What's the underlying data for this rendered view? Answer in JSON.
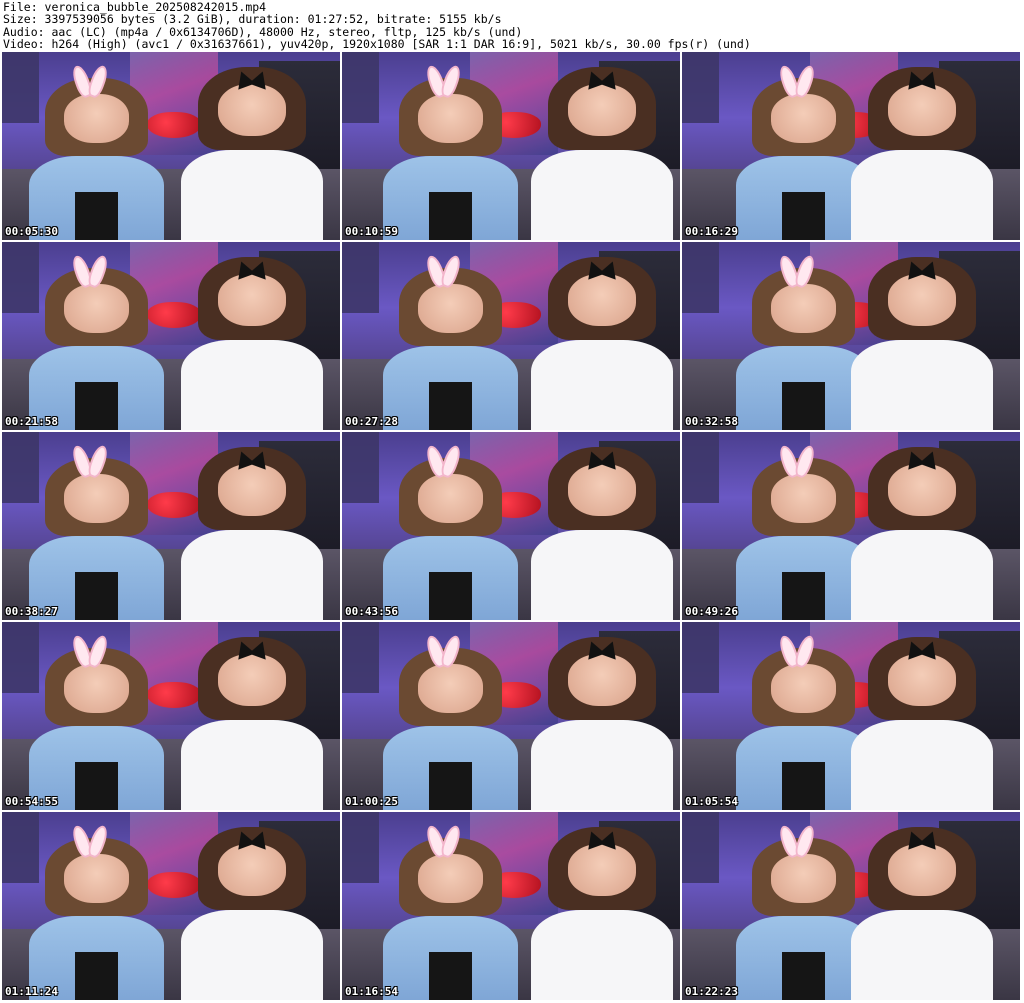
{
  "header": {
    "line1": "File: veronica_bubble_202508242015.mp4",
    "line2": "Size: 3397539056 bytes (3.2 GiB), duration: 01:27:52, bitrate: 5155 kb/s",
    "line3": "Audio: aac (LC) (mp4a / 0x6134706D), 48000 Hz, stereo, fltp, 125 kb/s (und)",
    "line4": "Video: h264 (High) (avc1 / 0x31637661), yuv420p, 1920x1080 [SAR 1:1 DAR 16:9], 5021 kb/s, 30.00 fps(r) (und)"
  },
  "thumbnails": [
    {
      "time": "00:05:30"
    },
    {
      "time": "00:10:59"
    },
    {
      "time": "00:16:29"
    },
    {
      "time": "00:21:58"
    },
    {
      "time": "00:27:28"
    },
    {
      "time": "00:32:58"
    },
    {
      "time": "00:38:27"
    },
    {
      "time": "00:43:56"
    },
    {
      "time": "00:49:26"
    },
    {
      "time": "00:54:55"
    },
    {
      "time": "01:00:25"
    },
    {
      "time": "01:05:54"
    },
    {
      "time": "01:11:24"
    },
    {
      "time": "01:16:54"
    },
    {
      "time": "01:22:23"
    }
  ],
  "grid": {
    "columns": 3,
    "rows": 5
  }
}
